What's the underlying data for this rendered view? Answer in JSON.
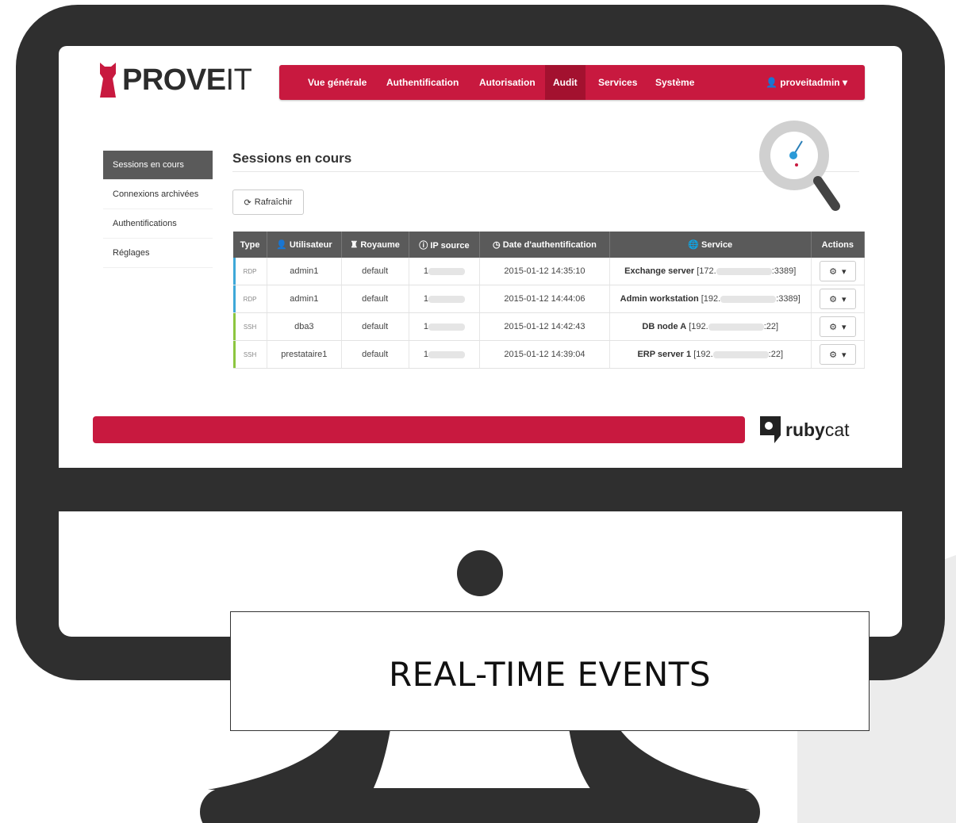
{
  "brand": {
    "name_bold": "PROVE",
    "name_light": "IT",
    "accent": "#c8193f"
  },
  "nav": {
    "items": [
      "Vue générale",
      "Authentification",
      "Autorisation",
      "Audit",
      "Services",
      "Système"
    ],
    "active": "Audit",
    "user": "proveitadmin"
  },
  "sidebar": {
    "items": [
      "Sessions en cours",
      "Connexions archivées",
      "Authentifications",
      "Réglages"
    ],
    "active": "Sessions en cours"
  },
  "main": {
    "title": "Sessions en cours",
    "refresh_label": "Rafraîchir"
  },
  "table": {
    "headers": [
      "Type",
      "Utilisateur",
      "Royaume",
      "IP source",
      "Date d'authentification",
      "Service",
      "Actions"
    ],
    "rows": [
      {
        "type": "RDP",
        "user": "admin1",
        "realm": "default",
        "ip": "1",
        "date": "2015-01-12 14:35:10",
        "service_name": "Exchange server",
        "service_prefix": "[172.",
        "service_suffix": ":3389]"
      },
      {
        "type": "RDP",
        "user": "admin1",
        "realm": "default",
        "ip": "1",
        "date": "2015-01-12 14:44:06",
        "service_name": "Admin workstation",
        "service_prefix": "[192.",
        "service_suffix": ":3389]"
      },
      {
        "type": "SSH",
        "user": "dba3",
        "realm": "default",
        "ip": "1",
        "date": "2015-01-12 14:42:43",
        "service_name": "DB node A",
        "service_prefix": "[192.",
        "service_suffix": ":22]"
      },
      {
        "type": "SSH",
        "user": "prestataire1",
        "realm": "default",
        "ip": "1",
        "date": "2015-01-12 14:39:04",
        "service_name": "ERP server 1",
        "service_prefix": "[192.",
        "service_suffix": ":22]"
      }
    ]
  },
  "footer": {
    "partner_bold": "ruby",
    "partner_light": "cat"
  },
  "caption": "REAL-TIME EVENTS",
  "colors": {
    "monitor": "#2f2f2f",
    "rdp_marker": "#3ea8d8",
    "ssh_marker": "#8cc63f"
  }
}
